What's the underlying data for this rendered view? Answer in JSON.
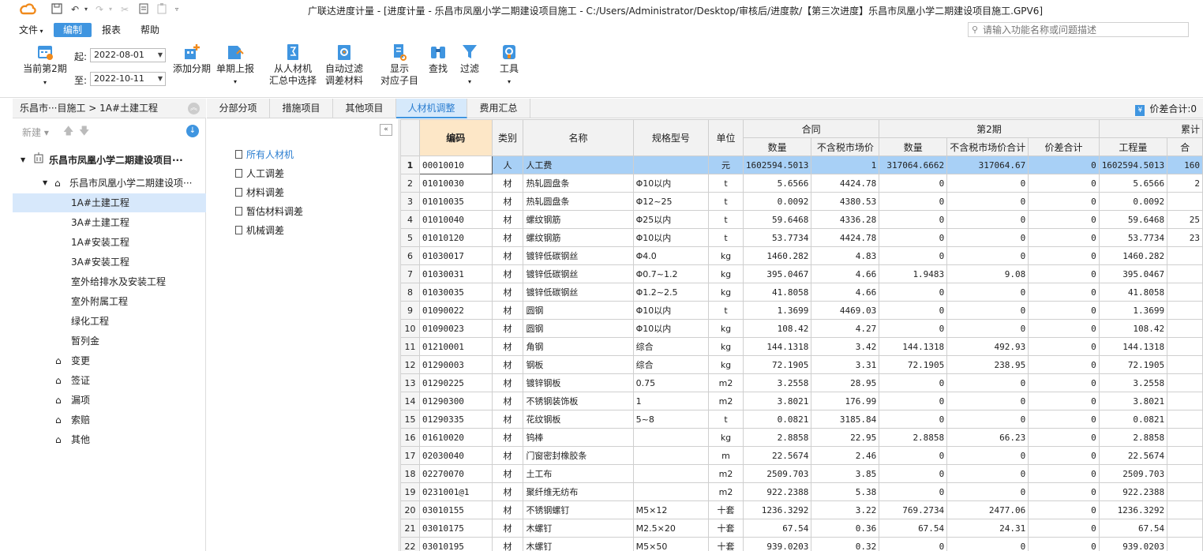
{
  "app": {
    "title": "广联达进度计量 - [进度计量 - 乐昌市凤凰小学二期建设项目施工 - C:/Users/Administrator/Desktop/审核后/进度款/【第三次进度】乐昌市凤凰小学二期建设项目施工.GPV6]"
  },
  "menu": {
    "items": [
      "文件",
      "编制",
      "报表",
      "帮助"
    ],
    "active": "编制",
    "search_placeholder": "请输入功能名称或问题描述"
  },
  "toolbar": {
    "current_period": "当前第2期",
    "start_label": "起:",
    "start_date": "2022-08-01",
    "end_label": "至:",
    "end_date": "2022-10-11",
    "buttons": [
      {
        "l1": "添加分期",
        "l2": ""
      },
      {
        "l1": "单期上报",
        "l2": ""
      },
      {
        "l1": "从人材机",
        "l2": "汇总中选择"
      },
      {
        "l1": "自动过滤",
        "l2": "调差材料"
      },
      {
        "l1": "显示",
        "l2": "对应子目"
      },
      {
        "l1": "查找",
        "l2": ""
      },
      {
        "l1": "过滤",
        "l2": ""
      },
      {
        "l1": "工具",
        "l2": ""
      }
    ]
  },
  "left": {
    "breadcrumb": "乐昌市···目施工 > 1A#土建工程",
    "new_label": "新建",
    "tree": [
      {
        "label": "乐昌市凤凰小学二期建设项目···",
        "level": 0
      },
      {
        "label": "乐昌市凤凰小学二期建设项···",
        "level": 1
      },
      {
        "label": "1A#土建工程",
        "level": 2
      },
      {
        "label": "3A#土建工程",
        "level": 2
      },
      {
        "label": "1A#安装工程",
        "level": 2
      },
      {
        "label": "3A#安装工程",
        "level": 2
      },
      {
        "label": "室外给排水及安装工程",
        "level": 2
      },
      {
        "label": "室外附属工程",
        "level": 2
      },
      {
        "label": "绿化工程",
        "level": 2
      },
      {
        "label": "暂列金",
        "level": 2
      },
      {
        "label": "变更",
        "level": 3
      },
      {
        "label": "签证",
        "level": 3
      },
      {
        "label": "漏项",
        "level": 3
      },
      {
        "label": "索赔",
        "level": 3
      },
      {
        "label": "其他",
        "level": 3
      }
    ]
  },
  "tabs": {
    "items": [
      "分部分项",
      "措施项目",
      "其他项目",
      "人材机调整",
      "费用汇总"
    ],
    "active": "人材机调整",
    "diff_total": "价差合计:0"
  },
  "categories": [
    "所有人材机",
    "人工调差",
    "材料调差",
    "暂估材料调差",
    "机械调差"
  ],
  "grid": {
    "headers": {
      "code": "编码",
      "type": "类别",
      "name": "名称",
      "spec": "规格型号",
      "unit": "单位",
      "contract": "合同",
      "period2": "第2期",
      "cumulative": "累计",
      "qty": "数量",
      "price": "不含税市场价",
      "p2_qty": "数量",
      "p2_price": "不含税市场价合计",
      "p2_diff": "价差合计",
      "cum_qty": "工程量",
      "cum_total": "合"
    },
    "rows": [
      [
        "1",
        "00010010",
        "人",
        "人工费",
        "",
        "元",
        "1602594.5013",
        "1",
        "317064.6662",
        "317064.67",
        "0",
        "1602594.5013",
        "160"
      ],
      [
        "2",
        "01010030",
        "材",
        "热轧圆盘条",
        "Φ10以内",
        "t",
        "5.6566",
        "4424.78",
        "0",
        "0",
        "0",
        "5.6566",
        "2"
      ],
      [
        "3",
        "01010035",
        "材",
        "热轧圆盘条",
        "Φ12~25",
        "t",
        "0.0092",
        "4380.53",
        "0",
        "0",
        "0",
        "0.0092",
        ""
      ],
      [
        "4",
        "01010040",
        "材",
        "螺纹钢筋",
        "Φ25以内",
        "t",
        "59.6468",
        "4336.28",
        "0",
        "0",
        "0",
        "59.6468",
        "25"
      ],
      [
        "5",
        "01010120",
        "材",
        "螺纹钢筋",
        "Φ10以内",
        "t",
        "53.7734",
        "4424.78",
        "0",
        "0",
        "0",
        "53.7734",
        "23"
      ],
      [
        "6",
        "01030017",
        "材",
        "镀锌低碳钢丝",
        "Φ4.0",
        "kg",
        "1460.282",
        "4.83",
        "0",
        "0",
        "0",
        "1460.282",
        ""
      ],
      [
        "7",
        "01030031",
        "材",
        "镀锌低碳钢丝",
        "Φ0.7~1.2",
        "kg",
        "395.0467",
        "4.66",
        "1.9483",
        "9.08",
        "0",
        "395.0467",
        ""
      ],
      [
        "8",
        "01030035",
        "材",
        "镀锌低碳钢丝",
        "Φ1.2~2.5",
        "kg",
        "41.8058",
        "4.66",
        "0",
        "0",
        "0",
        "41.8058",
        ""
      ],
      [
        "9",
        "01090022",
        "材",
        "圆钢",
        "Φ10以内",
        "t",
        "1.3699",
        "4469.03",
        "0",
        "0",
        "0",
        "1.3699",
        ""
      ],
      [
        "10",
        "01090023",
        "材",
        "圆钢",
        "Φ10以内",
        "kg",
        "108.42",
        "4.27",
        "0",
        "0",
        "0",
        "108.42",
        ""
      ],
      [
        "11",
        "01210001",
        "材",
        "角钢",
        "综合",
        "kg",
        "144.1318",
        "3.42",
        "144.1318",
        "492.93",
        "0",
        "144.1318",
        ""
      ],
      [
        "12",
        "01290003",
        "材",
        "钢板",
        "综合",
        "kg",
        "72.1905",
        "3.31",
        "72.1905",
        "238.95",
        "0",
        "72.1905",
        ""
      ],
      [
        "13",
        "01290225",
        "材",
        "镀锌钢板",
        "0.75",
        "m2",
        "3.2558",
        "28.95",
        "0",
        "0",
        "0",
        "3.2558",
        ""
      ],
      [
        "14",
        "01290300",
        "材",
        "不锈钢装饰板",
        "1",
        "m2",
        "3.8021",
        "176.99",
        "0",
        "0",
        "0",
        "3.8021",
        ""
      ],
      [
        "15",
        "01290335",
        "材",
        "花纹钢板",
        "5~8",
        "t",
        "0.0821",
        "3185.84",
        "0",
        "0",
        "0",
        "0.0821",
        ""
      ],
      [
        "16",
        "01610020",
        "材",
        "钨棒",
        "",
        "kg",
        "2.8858",
        "22.95",
        "2.8858",
        "66.23",
        "0",
        "2.8858",
        ""
      ],
      [
        "17",
        "02030040",
        "材",
        "门窗密封橡胶条",
        "",
        "m",
        "22.5674",
        "2.46",
        "0",
        "0",
        "0",
        "22.5674",
        ""
      ],
      [
        "18",
        "02270070",
        "材",
        "土工布",
        "",
        "m2",
        "2509.703",
        "3.85",
        "0",
        "0",
        "0",
        "2509.703",
        ""
      ],
      [
        "19",
        "0231001@1",
        "材",
        "聚纤维无纺布",
        "",
        "m2",
        "922.2388",
        "5.38",
        "0",
        "0",
        "0",
        "922.2388",
        ""
      ],
      [
        "20",
        "03010155",
        "材",
        "不锈钢螺钉",
        "M5×12",
        "十套",
        "1236.3292",
        "3.22",
        "769.2734",
        "2477.06",
        "0",
        "1236.3292",
        ""
      ],
      [
        "21",
        "03010175",
        "材",
        "木螺钉",
        "M2.5×20",
        "十套",
        "67.54",
        "0.36",
        "67.54",
        "24.31",
        "0",
        "67.54",
        ""
      ],
      [
        "22",
        "03010195",
        "材",
        "木螺钉",
        "M5×50",
        "十套",
        "939.0203",
        "0.32",
        "0",
        "0",
        "0",
        "939.0203",
        ""
      ]
    ]
  },
  "colors": {
    "accent": "#3f95e0",
    "selected_row": "#a8d0f6",
    "code_header": "#fde7c7",
    "tree_selected": "#d7e8fb"
  }
}
